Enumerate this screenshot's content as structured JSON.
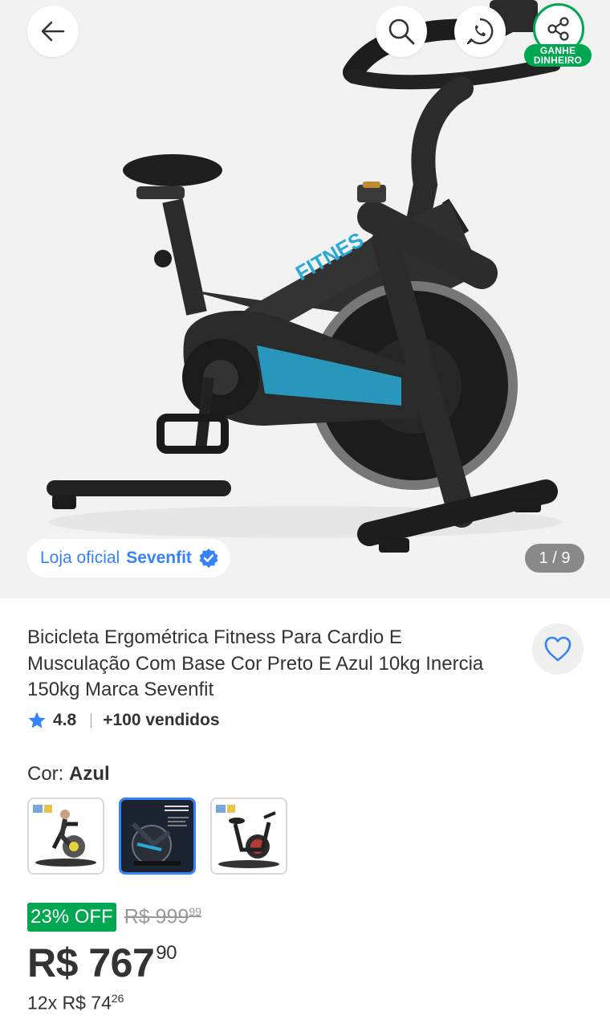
{
  "header": {
    "share_badge_line1": "GANHE",
    "share_badge_line2": "DINHEIRO"
  },
  "gallery": {
    "store_prefix": "Loja oficial",
    "store_name": "Sevenfit",
    "counter": "1 / 9",
    "bike_brand_text": "FITNES"
  },
  "product": {
    "title": "Bicicleta Ergométrica Fitness Para Cardio E Musculação Com Base Cor Preto E Azul 10kg Inercia 150kg Marca Sevenfit",
    "rating": "4.8",
    "sold": "+100 vendidos"
  },
  "color": {
    "label": "Cor:",
    "value": "Azul"
  },
  "pricing": {
    "discount": "23% OFF",
    "old_currency": "R$",
    "old_int": "999",
    "old_cents": "99",
    "currency": "R$",
    "price_int": "767",
    "price_cents": "90",
    "installments_prefix": "12x",
    "installment_currency": "R$",
    "installment_int": "74",
    "installment_cents": "26"
  },
  "colors": {
    "accent": "#3483fa",
    "success": "#00a650",
    "bike_accent": "#29a9d6"
  },
  "icons": [
    "arrow-left-icon",
    "search-icon",
    "whatsapp-icon",
    "share-icon",
    "verified-icon",
    "heart-icon",
    "star-icon"
  ]
}
